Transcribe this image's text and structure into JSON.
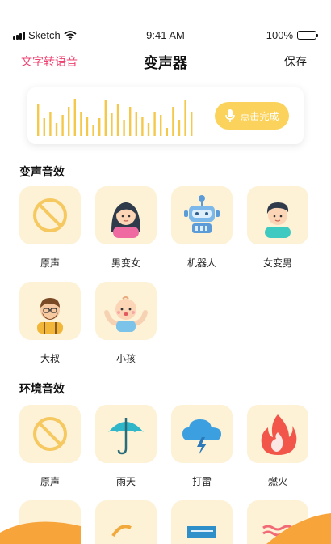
{
  "status": {
    "carrier": "Sketch",
    "time": "9:41 AM",
    "battery": "100%"
  },
  "nav": {
    "left": "文字转语音",
    "title": "变声器",
    "right": "保存"
  },
  "recorder": {
    "button_label": "点击完成",
    "accent": "#fbd35c",
    "bar_color": "#f3c84b"
  },
  "sections": [
    {
      "title": "变声音效",
      "items": [
        {
          "label": "原声",
          "icon": "no-effect-icon"
        },
        {
          "label": "男变女",
          "icon": "woman-icon"
        },
        {
          "label": "机器人",
          "icon": "robot-icon"
        },
        {
          "label": "女变男",
          "icon": "man-icon"
        },
        {
          "label": "大叔",
          "icon": "uncle-icon"
        },
        {
          "label": "小孩",
          "icon": "baby-icon"
        }
      ]
    },
    {
      "title": "环境音效",
      "items": [
        {
          "label": "原声",
          "icon": "no-effect-icon"
        },
        {
          "label": "雨天",
          "icon": "umbrella-icon"
        },
        {
          "label": "打雷",
          "icon": "thunder-cloud-icon"
        },
        {
          "label": "燃火",
          "icon": "fire-icon"
        }
      ]
    }
  ],
  "colors": {
    "pink": "#ef3f6e",
    "tile_bg": "#fdf1d6",
    "orange": "#f7a43b"
  }
}
